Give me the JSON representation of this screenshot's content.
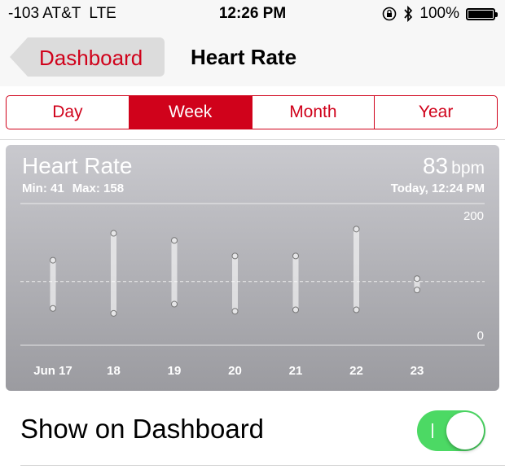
{
  "status": {
    "signal": "-103 AT&T",
    "network": "LTE",
    "time": "12:26 PM",
    "battery": "100%",
    "battery_level": 1.0,
    "icons": [
      "rotation-lock-icon",
      "bluetooth-icon",
      "battery-icon"
    ]
  },
  "nav": {
    "back_label": "Dashboard",
    "title": "Heart Rate"
  },
  "segments": {
    "items": [
      "Day",
      "Week",
      "Month",
      "Year"
    ],
    "selected": "Week"
  },
  "card": {
    "title": "Heart Rate",
    "min_label": "Min: 41",
    "max_label": "Max: 158",
    "value": "83",
    "unit": "bpm",
    "timestamp": "Today, 12:24 PM"
  },
  "chart_data": {
    "type": "range-bar",
    "categories": [
      "Jun 17",
      "18",
      "19",
      "20",
      "21",
      "22",
      "23"
    ],
    "series": [
      {
        "low": 52,
        "high": 120
      },
      {
        "low": 45,
        "high": 158
      },
      {
        "low": 58,
        "high": 148
      },
      {
        "low": 48,
        "high": 126
      },
      {
        "low": 50,
        "high": 126
      },
      {
        "low": 50,
        "high": 164
      },
      {
        "low": 78,
        "high": 94
      }
    ],
    "ylim": [
      0,
      200
    ],
    "y_ticks": [
      "200",
      "0"
    ],
    "average_line": 90,
    "grid": true
  },
  "dashboard": {
    "label": "Show on Dashboard",
    "toggle_on": true
  },
  "colors": {
    "accent": "#d0021b",
    "toggle_on": "#4cd964"
  }
}
